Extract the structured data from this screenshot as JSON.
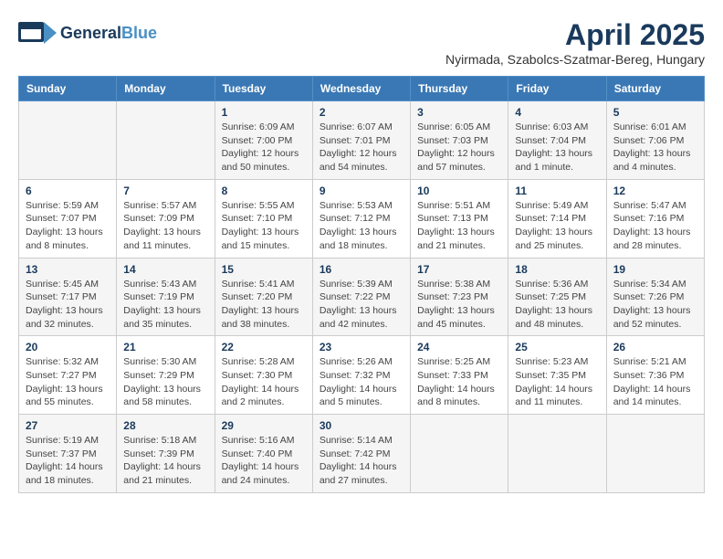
{
  "logo": {
    "general": "General",
    "blue": "Blue"
  },
  "title": {
    "month_year": "April 2025",
    "location": "Nyirmada, Szabolcs-Szatmar-Bereg, Hungary"
  },
  "headers": [
    "Sunday",
    "Monday",
    "Tuesday",
    "Wednesday",
    "Thursday",
    "Friday",
    "Saturday"
  ],
  "weeks": [
    [
      {
        "day": "",
        "detail": ""
      },
      {
        "day": "",
        "detail": ""
      },
      {
        "day": "1",
        "detail": "Sunrise: 6:09 AM\nSunset: 7:00 PM\nDaylight: 12 hours and 50 minutes."
      },
      {
        "day": "2",
        "detail": "Sunrise: 6:07 AM\nSunset: 7:01 PM\nDaylight: 12 hours and 54 minutes."
      },
      {
        "day": "3",
        "detail": "Sunrise: 6:05 AM\nSunset: 7:03 PM\nDaylight: 12 hours and 57 minutes."
      },
      {
        "day": "4",
        "detail": "Sunrise: 6:03 AM\nSunset: 7:04 PM\nDaylight: 13 hours and 1 minute."
      },
      {
        "day": "5",
        "detail": "Sunrise: 6:01 AM\nSunset: 7:06 PM\nDaylight: 13 hours and 4 minutes."
      }
    ],
    [
      {
        "day": "6",
        "detail": "Sunrise: 5:59 AM\nSunset: 7:07 PM\nDaylight: 13 hours and 8 minutes."
      },
      {
        "day": "7",
        "detail": "Sunrise: 5:57 AM\nSunset: 7:09 PM\nDaylight: 13 hours and 11 minutes."
      },
      {
        "day": "8",
        "detail": "Sunrise: 5:55 AM\nSunset: 7:10 PM\nDaylight: 13 hours and 15 minutes."
      },
      {
        "day": "9",
        "detail": "Sunrise: 5:53 AM\nSunset: 7:12 PM\nDaylight: 13 hours and 18 minutes."
      },
      {
        "day": "10",
        "detail": "Sunrise: 5:51 AM\nSunset: 7:13 PM\nDaylight: 13 hours and 21 minutes."
      },
      {
        "day": "11",
        "detail": "Sunrise: 5:49 AM\nSunset: 7:14 PM\nDaylight: 13 hours and 25 minutes."
      },
      {
        "day": "12",
        "detail": "Sunrise: 5:47 AM\nSunset: 7:16 PM\nDaylight: 13 hours and 28 minutes."
      }
    ],
    [
      {
        "day": "13",
        "detail": "Sunrise: 5:45 AM\nSunset: 7:17 PM\nDaylight: 13 hours and 32 minutes."
      },
      {
        "day": "14",
        "detail": "Sunrise: 5:43 AM\nSunset: 7:19 PM\nDaylight: 13 hours and 35 minutes."
      },
      {
        "day": "15",
        "detail": "Sunrise: 5:41 AM\nSunset: 7:20 PM\nDaylight: 13 hours and 38 minutes."
      },
      {
        "day": "16",
        "detail": "Sunrise: 5:39 AM\nSunset: 7:22 PM\nDaylight: 13 hours and 42 minutes."
      },
      {
        "day": "17",
        "detail": "Sunrise: 5:38 AM\nSunset: 7:23 PM\nDaylight: 13 hours and 45 minutes."
      },
      {
        "day": "18",
        "detail": "Sunrise: 5:36 AM\nSunset: 7:25 PM\nDaylight: 13 hours and 48 minutes."
      },
      {
        "day": "19",
        "detail": "Sunrise: 5:34 AM\nSunset: 7:26 PM\nDaylight: 13 hours and 52 minutes."
      }
    ],
    [
      {
        "day": "20",
        "detail": "Sunrise: 5:32 AM\nSunset: 7:27 PM\nDaylight: 13 hours and 55 minutes."
      },
      {
        "day": "21",
        "detail": "Sunrise: 5:30 AM\nSunset: 7:29 PM\nDaylight: 13 hours and 58 minutes."
      },
      {
        "day": "22",
        "detail": "Sunrise: 5:28 AM\nSunset: 7:30 PM\nDaylight: 14 hours and 2 minutes."
      },
      {
        "day": "23",
        "detail": "Sunrise: 5:26 AM\nSunset: 7:32 PM\nDaylight: 14 hours and 5 minutes."
      },
      {
        "day": "24",
        "detail": "Sunrise: 5:25 AM\nSunset: 7:33 PM\nDaylight: 14 hours and 8 minutes."
      },
      {
        "day": "25",
        "detail": "Sunrise: 5:23 AM\nSunset: 7:35 PM\nDaylight: 14 hours and 11 minutes."
      },
      {
        "day": "26",
        "detail": "Sunrise: 5:21 AM\nSunset: 7:36 PM\nDaylight: 14 hours and 14 minutes."
      }
    ],
    [
      {
        "day": "27",
        "detail": "Sunrise: 5:19 AM\nSunset: 7:37 PM\nDaylight: 14 hours and 18 minutes."
      },
      {
        "day": "28",
        "detail": "Sunrise: 5:18 AM\nSunset: 7:39 PM\nDaylight: 14 hours and 21 minutes."
      },
      {
        "day": "29",
        "detail": "Sunrise: 5:16 AM\nSunset: 7:40 PM\nDaylight: 14 hours and 24 minutes."
      },
      {
        "day": "30",
        "detail": "Sunrise: 5:14 AM\nSunset: 7:42 PM\nDaylight: 14 hours and 27 minutes."
      },
      {
        "day": "",
        "detail": ""
      },
      {
        "day": "",
        "detail": ""
      },
      {
        "day": "",
        "detail": ""
      }
    ]
  ]
}
